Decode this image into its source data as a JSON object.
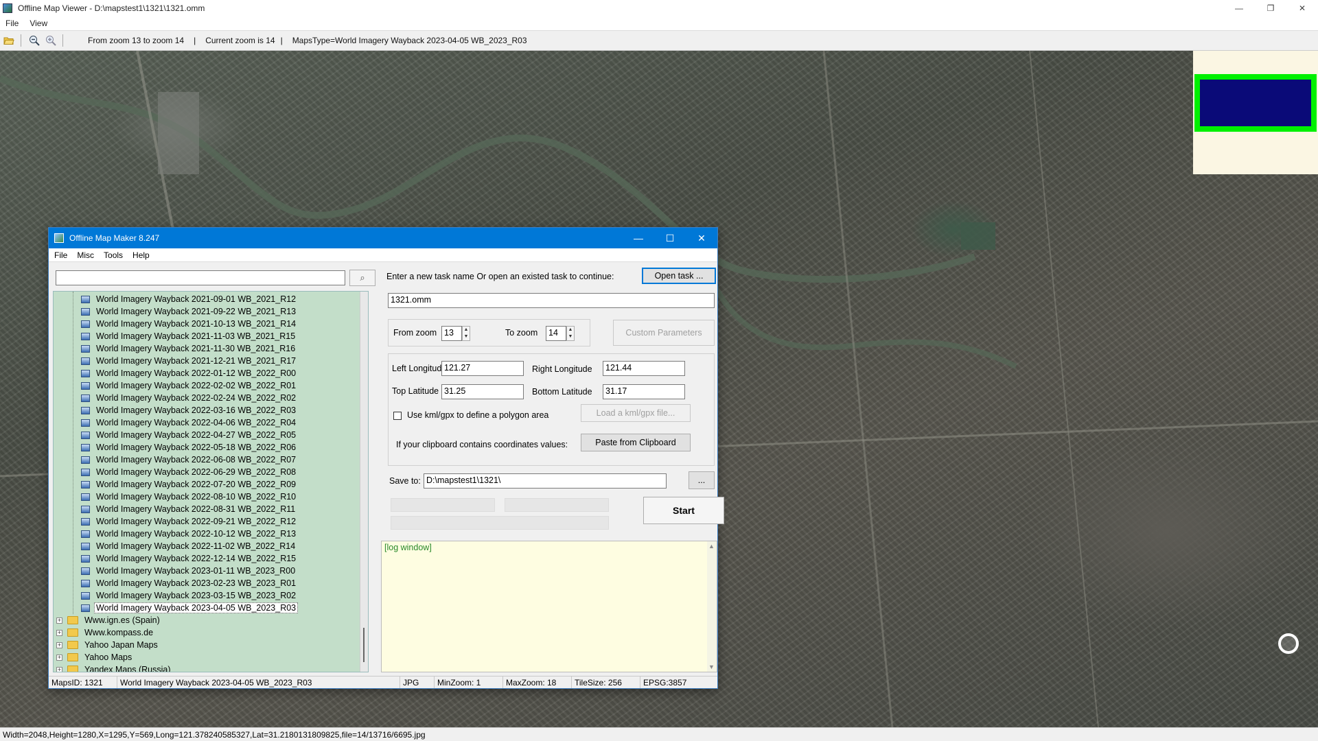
{
  "window": {
    "title": "Offline Map Viewer - D:\\mapstest1\\1321\\1321.omm",
    "minimize": "—",
    "maximize": "❐",
    "close": "✕"
  },
  "menu": {
    "items": [
      "File",
      "View"
    ]
  },
  "toolbar": {
    "zoom_range": "From zoom 13 to zoom 14",
    "current_zoom": "Current zoom is 14",
    "maps_type": "MapsType=World Imagery Wayback 2023-04-05 WB_2023_R03",
    "separator": "|"
  },
  "status": {
    "text": "Width=2048,Height=1280,X=1295,Y=569,Long=121.378240585327,Lat=31.2180131809825,file=14/13716/6695.jpg"
  },
  "dialog": {
    "title": "Offline Map Maker 8.247",
    "minimize": "—",
    "maximize": "☐",
    "close": "✕",
    "menu": [
      "File",
      "Misc",
      "Tools",
      "Help"
    ],
    "search": {
      "value": "",
      "button_icon": "⌕"
    },
    "tree": {
      "wayback_items": [
        "World Imagery Wayback 2021-09-01 WB_2021_R12",
        "World Imagery Wayback 2021-09-22 WB_2021_R13",
        "World Imagery Wayback 2021-10-13 WB_2021_R14",
        "World Imagery Wayback 2021-11-03 WB_2021_R15",
        "World Imagery Wayback 2021-11-30 WB_2021_R16",
        "World Imagery Wayback 2021-12-21 WB_2021_R17",
        "World Imagery Wayback 2022-01-12 WB_2022_R00",
        "World Imagery Wayback 2022-02-02 WB_2022_R01",
        "World Imagery Wayback 2022-02-24 WB_2022_R02",
        "World Imagery Wayback 2022-03-16 WB_2022_R03",
        "World Imagery Wayback 2022-04-06 WB_2022_R04",
        "World Imagery Wayback 2022-04-27 WB_2022_R05",
        "World Imagery Wayback 2022-05-18 WB_2022_R06",
        "World Imagery Wayback 2022-06-08 WB_2022_R07",
        "World Imagery Wayback 2022-06-29 WB_2022_R08",
        "World Imagery Wayback 2022-07-20 WB_2022_R09",
        "World Imagery Wayback 2022-08-10 WB_2022_R10",
        "World Imagery Wayback 2022-08-31 WB_2022_R11",
        "World Imagery Wayback 2022-09-21 WB_2022_R12",
        "World Imagery Wayback 2022-10-12 WB_2022_R13",
        "World Imagery Wayback 2022-11-02 WB_2022_R14",
        "World Imagery Wayback 2022-12-14 WB_2022_R15",
        "World Imagery Wayback 2023-01-11 WB_2023_R00",
        "World Imagery Wayback 2023-02-23 WB_2023_R01",
        "World Imagery Wayback 2023-03-15 WB_2023_R02",
        "World Imagery Wayback 2023-04-05 WB_2023_R03"
      ],
      "selected_index": 25,
      "folders": [
        "Www.ign.es (Spain)",
        "Www.kompass.de",
        "Yahoo Japan Maps",
        "Yahoo Maps",
        "Yandex Maps (Russia)"
      ]
    },
    "task": {
      "prompt": "Enter a new task name Or open an existed task to continue:",
      "open_label": "Open task ...",
      "name_value": "1321.omm"
    },
    "zoom": {
      "from_label": "From zoom",
      "from_value": "13",
      "to_label": "To zoom",
      "to_value": "14",
      "custom_label": "Custom Parameters"
    },
    "coords": {
      "left_lon_label": "Left Longitude",
      "left_lon_value": "121.27",
      "right_lon_label": "Right Longitude",
      "right_lon_value": "121.44",
      "top_lat_label": "Top Latitude",
      "top_lat_value": "31.25",
      "bottom_lat_label": "Bottom Latitude",
      "bottom_lat_value": "31.17",
      "kml_label": "Use kml/gpx to define a polygon area",
      "kml_checked": false,
      "load_kml_label": "Load a kml/gpx file...",
      "clipboard_label": "If your clipboard contains coordinates values:",
      "paste_label": "Paste from Clipboard"
    },
    "save": {
      "label": "Save to:",
      "value": "D:\\mapstest1\\1321\\",
      "browse_label": "..."
    },
    "start_label": "Start",
    "log_label": "[log window]",
    "statusbar": {
      "maps_id": "MapsID: 1321",
      "map_name": "World Imagery Wayback 2023-04-05 WB_2023_R03",
      "format": "JPG",
      "min_zoom": "MinZoom: 1",
      "max_zoom": "MaxZoom: 18",
      "tile_size": "TileSize: 256",
      "epsg": "EPSG:3857"
    }
  },
  "colors": {
    "dialog_titlebar": "#0078d7",
    "tree_background": "#c3dec9",
    "log_background": "#fefde1",
    "overview_frame": "#00f000",
    "overview_fill": "#0a0a78"
  },
  "icons": {
    "open": "folder-open-icon",
    "zoom_out": "zoom-out-icon",
    "zoom_in": "zoom-in-icon",
    "search": "magnifier-icon"
  }
}
